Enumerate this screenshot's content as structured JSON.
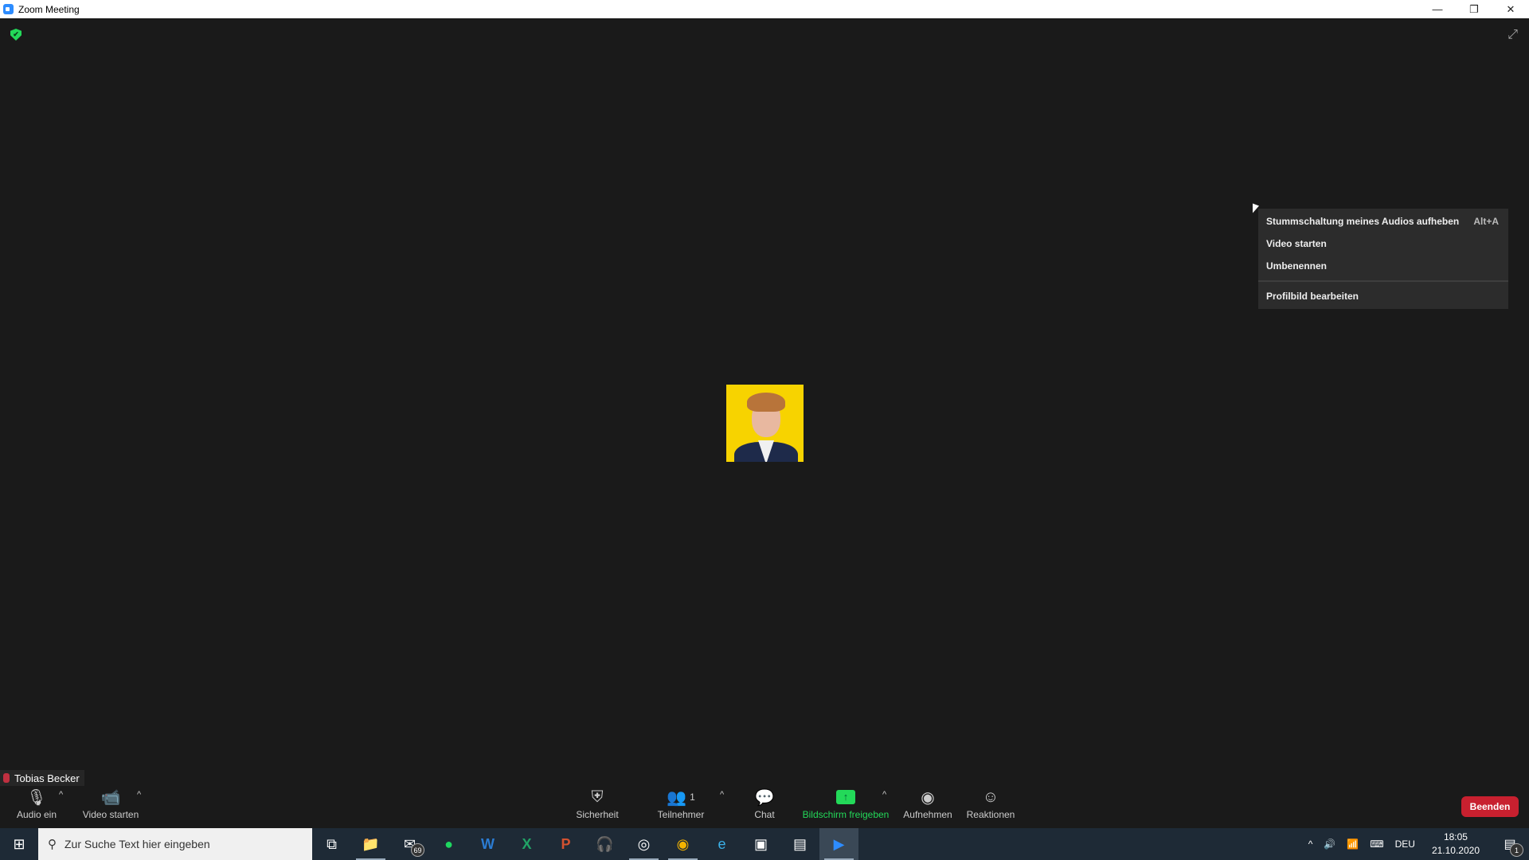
{
  "window": {
    "title": "Zoom Meeting",
    "minimize": "—",
    "restore": "❐",
    "close": "✕"
  },
  "stage": {
    "fullscreen_icon": "⤢",
    "encryption_icon": "✔"
  },
  "context_menu": {
    "items": [
      {
        "label": "Stummschaltung meines Audios aufheben",
        "shortcut": "Alt+A"
      },
      {
        "label": "Video starten",
        "shortcut": ""
      },
      {
        "label": "Umbenennen",
        "shortcut": ""
      },
      {
        "label": "Profilbild bearbeiten",
        "shortcut": ""
      }
    ]
  },
  "participant": {
    "name": "Tobias Becker"
  },
  "toolbar": {
    "audio": {
      "label": "Audio ein",
      "icon": "🎙"
    },
    "video": {
      "label": "Video starten",
      "icon": "📹"
    },
    "security": {
      "label": "Sicherheit",
      "icon": "⛨"
    },
    "participants": {
      "label": "Teilnehmer",
      "count": "1",
      "icon": "👥"
    },
    "chat": {
      "label": "Chat",
      "icon": "💬"
    },
    "share": {
      "label": "Bildschirm freigeben",
      "icon": "↑"
    },
    "record": {
      "label": "Aufnehmen",
      "icon": "◉"
    },
    "reactions": {
      "label": "Reaktionen",
      "icon": "☺"
    },
    "caret": "^",
    "end": "Beenden",
    "accent_share": "#23d959",
    "end_color": "#c8202f"
  },
  "taskbar": {
    "start_icon": "⊞",
    "search_placeholder": "Zur Suche Text hier eingeben",
    "apps": [
      {
        "name": "task-view",
        "glyph": "⧉"
      },
      {
        "name": "file-explorer",
        "glyph": "📁"
      },
      {
        "name": "mail",
        "glyph": "✉",
        "badge": "69"
      },
      {
        "name": "spotify",
        "glyph": "●"
      },
      {
        "name": "word",
        "glyph": "W"
      },
      {
        "name": "excel",
        "glyph": "X"
      },
      {
        "name": "powerpoint",
        "glyph": "P"
      },
      {
        "name": "audacity",
        "glyph": "🎧"
      },
      {
        "name": "obs",
        "glyph": "◎"
      },
      {
        "name": "chrome",
        "glyph": "◉"
      },
      {
        "name": "edge",
        "glyph": "e"
      },
      {
        "name": "app-1",
        "glyph": "▣"
      },
      {
        "name": "app-2",
        "glyph": "▤"
      },
      {
        "name": "zoom",
        "glyph": "▶"
      }
    ],
    "tray": {
      "chevron": "^",
      "volume": "🔊",
      "network": "📶",
      "keyboard": "⌨",
      "language": "DEU",
      "time": "18:05",
      "date": "21.10.2020",
      "notifications": "1"
    }
  }
}
